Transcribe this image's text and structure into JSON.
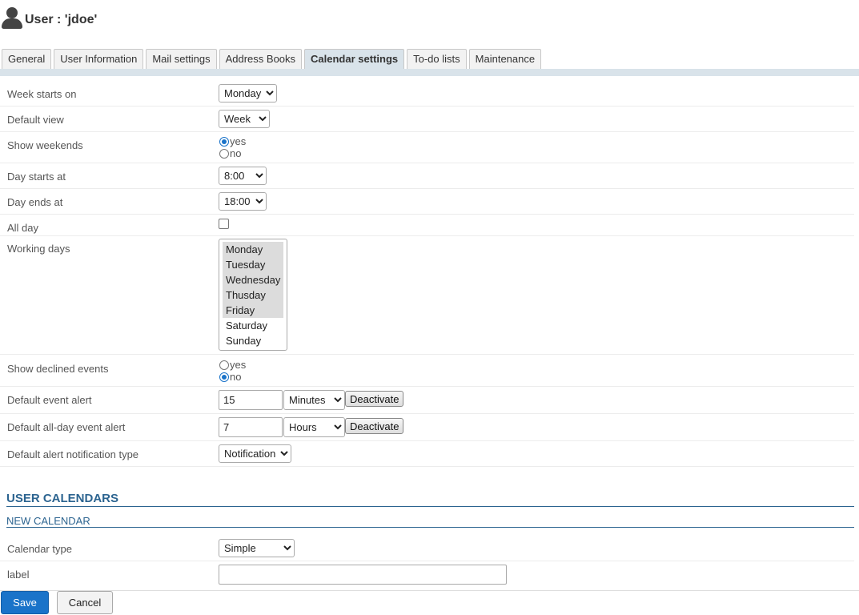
{
  "header": {
    "title": "User : 'jdoe'"
  },
  "tabs": [
    {
      "label": "General"
    },
    {
      "label": "User Information"
    },
    {
      "label": "Mail settings"
    },
    {
      "label": "Address Books"
    },
    {
      "label": "Calendar settings"
    },
    {
      "label": "To-do lists"
    },
    {
      "label": "Maintenance"
    }
  ],
  "active_tab": "Calendar settings",
  "form": {
    "week_starts_on": {
      "label": "Week starts on",
      "value": "Monday"
    },
    "default_view": {
      "label": "Default view",
      "value": "Week"
    },
    "show_weekends": {
      "label": "Show weekends",
      "yes": "yes",
      "no": "no",
      "selected": "yes"
    },
    "day_starts_at": {
      "label": "Day starts at",
      "value": "8:00"
    },
    "day_ends_at": {
      "label": "Day ends at",
      "value": "18:00"
    },
    "all_day": {
      "label": "All day",
      "checked": false
    },
    "working_days": {
      "label": "Working days",
      "options": [
        "Monday",
        "Tuesday",
        "Wednesday",
        "Thusday",
        "Friday",
        "Saturday",
        "Sunday"
      ],
      "selected": [
        "Monday",
        "Tuesday",
        "Wednesday",
        "Thusday",
        "Friday"
      ]
    },
    "show_declined_events": {
      "label": "Show declined events",
      "yes": "yes",
      "no": "no",
      "selected": "no"
    },
    "default_event_alert": {
      "label": "Default event alert",
      "value": "15",
      "unit": "Minutes",
      "button": "Deactivate"
    },
    "default_allday_event_alert": {
      "label": "Default all-day event alert",
      "value": "7",
      "unit": "Hours",
      "button": "Deactivate"
    },
    "default_alert_notification_type": {
      "label": "Default alert notification type",
      "value": "Notification"
    }
  },
  "user_calendars": {
    "title": "USER CALENDARS",
    "new_calendar": "NEW CALENDAR",
    "calendar_type": {
      "label": "Calendar type",
      "value": "Simple"
    },
    "label_field": {
      "label": "label",
      "value": ""
    }
  },
  "footer": {
    "save": "Save",
    "cancel": "Cancel"
  },
  "colors": {
    "accent": "#1a73c9",
    "section": "#2c6490",
    "tab_active_bg": "#d9e3ea"
  }
}
